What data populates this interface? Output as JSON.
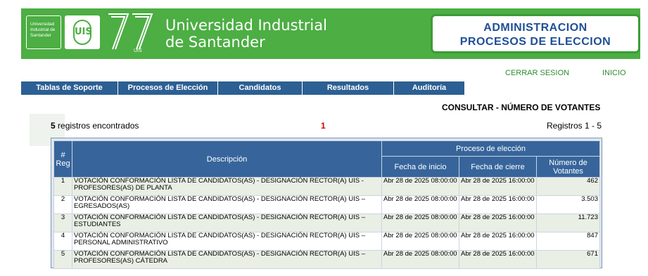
{
  "header": {
    "logo_small_lines": [
      "Universidad",
      "Industrial de",
      "Santander"
    ],
    "logo_uis": "UIS",
    "anniversary": "77",
    "anniversary_sub": "UIS",
    "university_line1": "Universidad Industrial",
    "university_line2": "de Santander",
    "admin_line1": "ADMINISTRACION",
    "admin_line2": "PROCESOS DE ELECCION",
    "brand_color": "#4cae43"
  },
  "top_links": {
    "logout": "CERRAR SESION",
    "home": "INICIO"
  },
  "nav": [
    "Tablas de Soporte",
    "Procesos de Elección",
    "Candidatos",
    "Resultados",
    "Auditoría"
  ],
  "page": {
    "title": "CONSULTAR - NÚMERO DE VOTANTES",
    "records_count": "5",
    "records_label": "registros encontrados",
    "current_page": "1",
    "records_range": "Registros 1 - 5"
  },
  "table": {
    "headers": {
      "reg": "# Reg",
      "description": "Descripción",
      "process_group": "Proceso de elección",
      "start_date": "Fecha de inicio",
      "end_date": "Fecha de cierre",
      "voters": "Número de Votantes"
    },
    "rows": [
      {
        "n": "1",
        "desc": "VOTACIÓN CONFORMACIÓN LISTA DE CANDIDATOS(AS) - DESIGNACIÓN RECTOR(A) UIS - PROFESORES(AS) DE PLANTA",
        "start": "Abr 28 de 2025 08:00:00",
        "end": "Abr 28 de 2025 16:00:00",
        "voters": "462"
      },
      {
        "n": "2",
        "desc": "VOTACIÓN CONFORMACIÓN LISTA DE CANDIDATOS(AS) - DESIGNACIÓN RECTOR(A) UIS – EGRESADOS(AS)",
        "start": "Abr 28 de 2025 08:00:00",
        "end": "Abr 28 de 2025 16:00:00",
        "voters": "3.503"
      },
      {
        "n": "3",
        "desc": "VOTACIÓN CONFORMACIÓN LISTA DE CANDIDATOS(AS) - DESIGNACIÓN RECTOR(A) UIS – ESTUDIANTES",
        "start": "Abr 28 de 2025 08:00:00",
        "end": "Abr 28 de 2025 16:00:00",
        "voters": "11.723"
      },
      {
        "n": "4",
        "desc": "VOTACIÓN CONFORMACIÓN LISTA DE CANDIDATOS(AS) - DESIGNACIÓN RECTOR(A) UIS – PERSONAL ADMINISTRATIVO",
        "start": "Abr 28 de 2025 08:00:00",
        "end": "Abr 28 de 2025 16:00:00",
        "voters": "847"
      },
      {
        "n": "5",
        "desc": "VOTACIÓN CONFORMACIÓN LISTA DE CANDIDATOS(AS) - DESIGNACIÓN RECTOR(A) UIS – PROFESORES(AS) CÁTEDRA",
        "start": "Abr 28 de 2025 08:00:00",
        "end": "Abr 28 de 2025 16:00:00",
        "voters": "671"
      }
    ]
  }
}
